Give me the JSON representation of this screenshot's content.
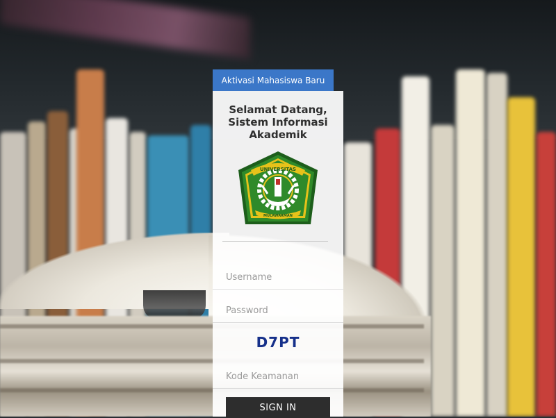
{
  "header": {
    "activation_button": "Aktivasi Mahasiswa Baru"
  },
  "welcome": {
    "line1": "Selamat Datang,",
    "line2": "Sistem Informasi",
    "line3": "Akademik"
  },
  "logo": {
    "top_text": "UNIVERSITAS",
    "bottom_text": "MULAWARMAN",
    "colors": {
      "green": "#2f8a2a",
      "dark_green": "#1d5e1b",
      "yellow": "#e6c21a"
    }
  },
  "form": {
    "username_placeholder": "Username",
    "password_placeholder": "Password",
    "captcha_code": "D7PT",
    "security_code_placeholder": "Kode Keamanan",
    "submit_label": "SIGN IN"
  },
  "colors": {
    "tab_blue": "#3b77c8",
    "signin_dark": "#2d2d2d",
    "captcha_blue": "#16308a"
  }
}
